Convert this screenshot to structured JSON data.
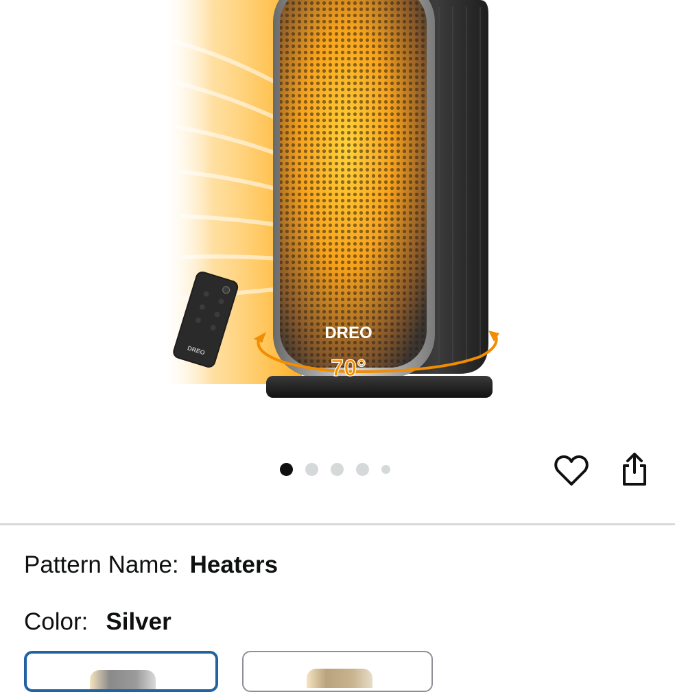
{
  "product": {
    "brand_logo_text": "DREO",
    "rotation_label": "70°"
  },
  "remote": {
    "brand_text": "DREO"
  },
  "carousel": {
    "total_images": 5,
    "active_index": 0
  },
  "actions": {
    "favorite_icon": "heart-icon",
    "share_icon": "share-icon"
  },
  "variations": {
    "pattern": {
      "label": "Pattern Name:",
      "value": "Heaters"
    },
    "color": {
      "label": "Color:",
      "value": "Silver",
      "options": [
        {
          "selected": true
        },
        {
          "selected": false
        }
      ]
    }
  },
  "colors": {
    "selected_border": "#2162a1",
    "unselected_border": "#8d9096",
    "active_dot": "#0f1111",
    "inactive_dot": "#d5d9d9",
    "heat_glow": "#ffb300",
    "heater_body": "#1c1c1c",
    "rotation_arrow": "#f28c00"
  }
}
